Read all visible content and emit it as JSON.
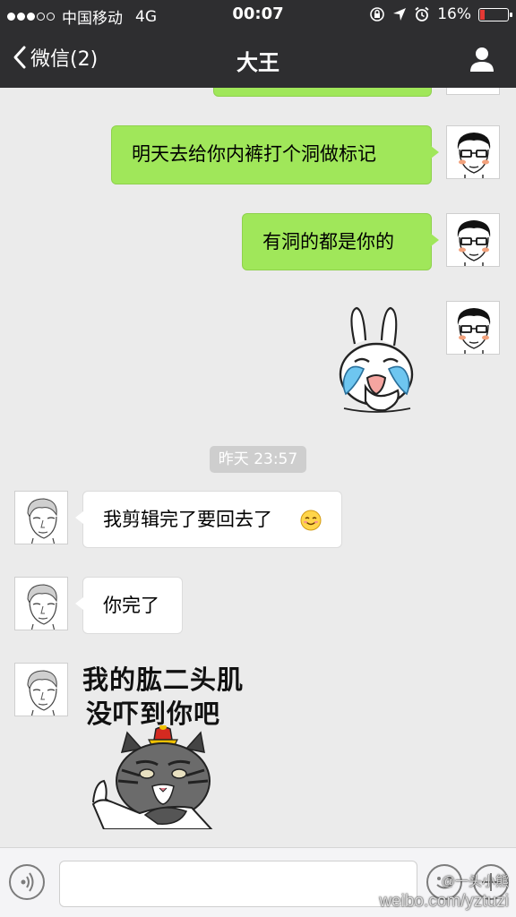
{
  "status_bar": {
    "carrier": "中国移动",
    "network": "4G",
    "time": "00:07",
    "battery": "16%",
    "battery_level": 0.16,
    "signal_dots_filled": 3,
    "signal_dots_total": 5
  },
  "nav": {
    "back_label": "微信(2)",
    "title": "大王",
    "profile_icon": "person-icon"
  },
  "messages": [
    {
      "side": "out",
      "text": "明天去给你内裤打个洞做标记"
    },
    {
      "side": "out",
      "text": "有洞的都是你的"
    },
    {
      "side": "out",
      "sticker": "crying-bunny-sticker"
    },
    {
      "side": "in",
      "text": "我剪辑完了要回去了",
      "emoji": "smile-emoji"
    },
    {
      "side": "in",
      "text": "你完了"
    },
    {
      "side": "in",
      "sticker": "cat-sticker",
      "sticker_text_line1": "我的肱二头肌",
      "sticker_text_line2": "没吓到你吧"
    }
  ],
  "timestamp": "昨天 23:57",
  "input_bar": {
    "voice_icon": "voice-icon",
    "emoji_icon": "emoji-icon",
    "plus_icon": "plus-icon"
  },
  "watermark": {
    "line1": "@一头小熊",
    "line2": "weibo.com/yztuzi"
  },
  "colors": {
    "nav_bg": "#2e2e30",
    "chat_bg": "#ebebeb",
    "outgoing_bubble": "#a0e75a",
    "incoming_bubble": "#ffffff"
  }
}
